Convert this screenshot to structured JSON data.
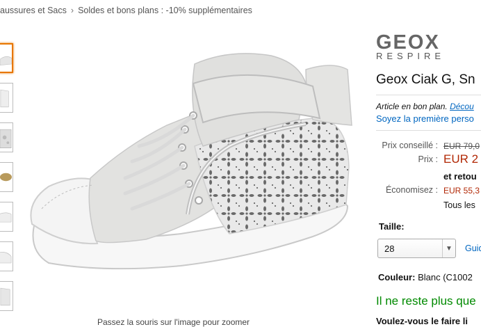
{
  "breadcrumb": {
    "items": [
      "aussures et Sacs",
      "Soldes et bons plans : -10% supplémentaires"
    ],
    "separator": "›"
  },
  "thumbnails": {
    "count": 7,
    "active_index": 0
  },
  "image_caption": "Passez la souris sur l'image pour zoomer",
  "brand": {
    "logo_text": "GEOX",
    "logo_sub": "RESPIRE"
  },
  "product": {
    "title": "Geox Ciak G, Sn"
  },
  "offer": {
    "text": "Article en bon plan.",
    "link": "Décou"
  },
  "review_link": "Soyez la première perso",
  "pricing": {
    "list_label": "Prix conseillé :",
    "list_value": "EUR 79,0",
    "price_label": "Prix :",
    "price_value": "EUR 2",
    "shipping": "et retou",
    "savings_label": "Économisez :",
    "savings_value": "EUR 55,3",
    "all_prices": "Tous les"
  },
  "size": {
    "label": "Taille:",
    "selected": "28",
    "guide": "Guid"
  },
  "color": {
    "label": "Couleur:",
    "value": "Blanc (C1002"
  },
  "stock": "Il ne reste plus que",
  "wishlist": "Voulez-vous le faire li",
  "colors": {
    "link": "#0066c0",
    "price": "#b12704",
    "stock": "#008a00",
    "active_thumb": "#e77600"
  }
}
